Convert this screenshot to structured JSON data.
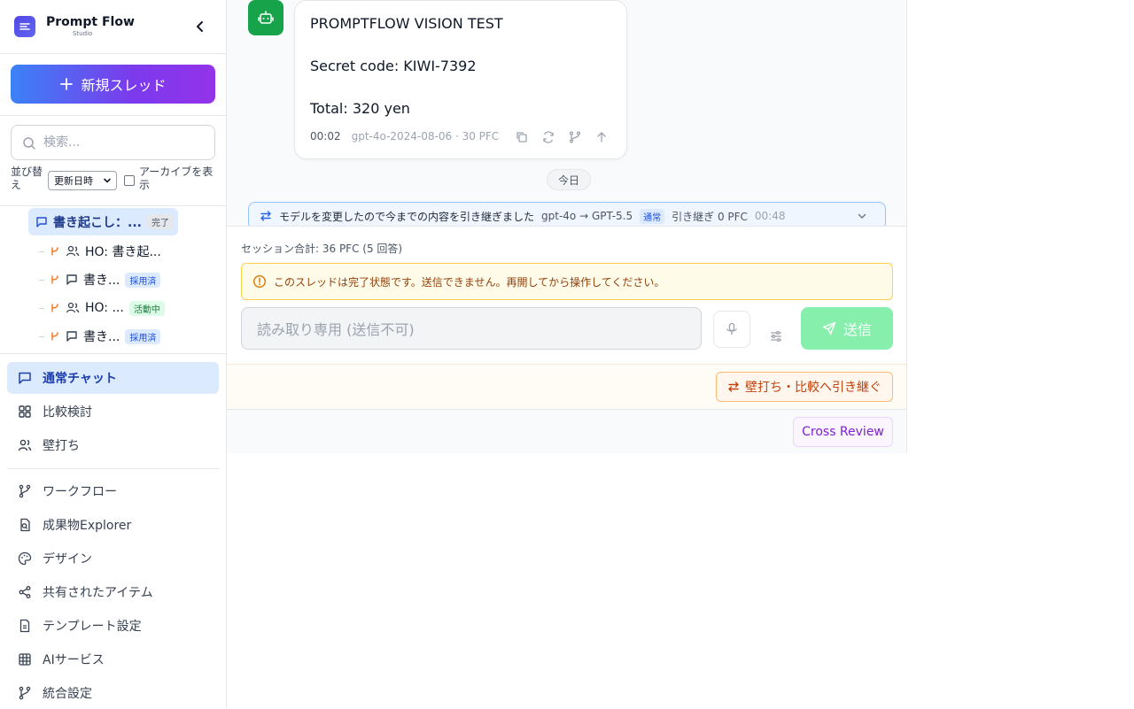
{
  "app": {
    "name": "Prompt Flow",
    "subtitle": "Studio"
  },
  "sidebar": {
    "new_thread_label": "新規スレッド",
    "search_placeholder": "検索...",
    "sort_label": "並び替え",
    "sort_value": "更新日時",
    "archive_label": "アーカイブを表示",
    "archive_checked": false,
    "threads": {
      "main": {
        "title": "書き起こし：...",
        "badge": "完了"
      },
      "children": [
        {
          "icon": "users-icon",
          "title": "HO: 書き起...",
          "badge": ""
        },
        {
          "icon": "chat-icon",
          "title": "書き...",
          "badge": "採用済"
        },
        {
          "icon": "users-icon",
          "title": "HO: ...",
          "badge": "活動中"
        },
        {
          "icon": "chat-icon",
          "title": "書き...",
          "badge": "採用済"
        }
      ]
    },
    "modes": [
      {
        "icon": "chat-icon",
        "label": "通常チャット",
        "active": true
      },
      {
        "icon": "grid-icon",
        "label": "比較検討",
        "active": false
      },
      {
        "icon": "users-icon",
        "label": "壁打ち",
        "active": false
      }
    ],
    "nav": [
      {
        "icon": "branch-icon",
        "label": "ワークフロー"
      },
      {
        "icon": "file-search-icon",
        "label": "成果物Explorer"
      },
      {
        "icon": "palette-icon",
        "label": "デザイン"
      },
      {
        "icon": "share-icon",
        "label": "共有されたアイテム"
      },
      {
        "icon": "document-icon",
        "label": "テンプレート設定"
      },
      {
        "icon": "table-icon",
        "label": "AIサービス"
      },
      {
        "icon": "branch-icon",
        "label": "統合設定"
      }
    ]
  },
  "chat": {
    "message": {
      "lines": [
        "PROMPTFLOW VISION TEST",
        "Secret code: KIWI-7392",
        "Total: 320 yen"
      ],
      "time": "00:02",
      "model_info": "gpt-4o-2024-08-06 · 30 PFC"
    },
    "date_separator": "今日",
    "handoff": {
      "text": "モデルを変更したので今までの内容を引き継ぎました",
      "models": "gpt-4o → GPT-5.5",
      "badge": "通常",
      "pfc": "引き継ぎ 0 PFC",
      "time": "00:48"
    }
  },
  "composer": {
    "session_total": "セッション合計: 36 PFC (5 回答)",
    "warning": "このスレッドは完了状態です。送信できません。再開してから操作してください。",
    "input_placeholder": "読み取り専用 (送信不可)",
    "send_label": "送信",
    "handoff_button": "壁打ち・比較へ引き継ぐ",
    "review_button": "Cross Review"
  },
  "colors": {
    "accent": "#3b82f6",
    "send_disabled": "#86efac",
    "warning_bg": "#fefce8",
    "handoff_orange": "#c2410c",
    "review_purple": "#7e22ce"
  }
}
